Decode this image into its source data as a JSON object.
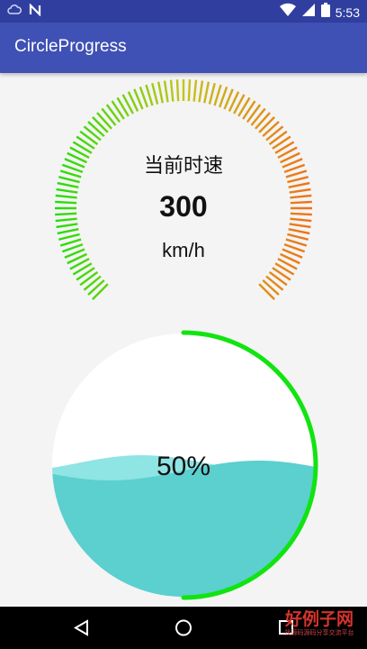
{
  "status_bar": {
    "time": "5:53",
    "icons": [
      "cloud-icon",
      "n-icon",
      "wifi-icon",
      "signal-icon",
      "battery-icon"
    ]
  },
  "app_bar": {
    "title": "CircleProgress"
  },
  "speed_gauge": {
    "label": "当前时速",
    "value": "300",
    "unit": "km/h",
    "colors": {
      "start": "#22dd0a",
      "middle": "#c4c41a",
      "end": "#f07018"
    }
  },
  "wave_progress": {
    "percent_text": "50%",
    "level": 0.5,
    "colors": {
      "arc": "#11e411",
      "wave_front": "#5ccfcf",
      "wave_back": "#8fe4e4"
    }
  },
  "nav_bar": {
    "buttons": [
      "back-button",
      "home-button",
      "recents-button"
    ]
  },
  "watermark": {
    "title": "好例子网",
    "subtitle": "找源码源码分享交流平台"
  }
}
